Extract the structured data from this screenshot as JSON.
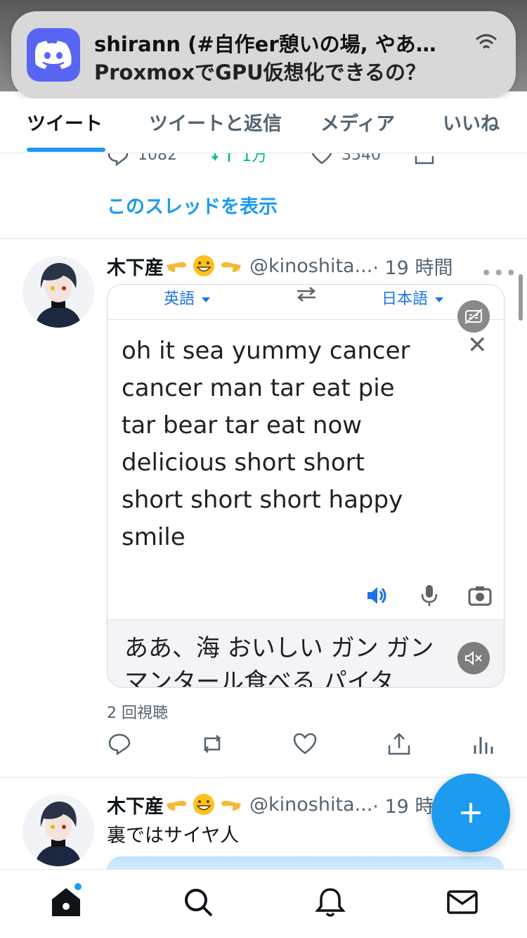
{
  "notification": {
    "app_icon": "discord-icon",
    "title": "shirann (#自作er憩いの場, やあ…",
    "body": "ProxmoxでGPU仮想化できるの？"
  },
  "tabs": [
    {
      "label": "ツイート",
      "active": true
    },
    {
      "label": "ツイートと返信",
      "active": false
    },
    {
      "label": "メディア",
      "active": false
    },
    {
      "label": "いいね",
      "active": false
    }
  ],
  "previous_tweet": {
    "replies": "1082",
    "retweets": "1万",
    "likes": "3540",
    "thread_link": "このスレッドを表示"
  },
  "tweet1": {
    "name": "木下産",
    "emojis": [
      "backhand-index-pointing-right",
      "grinning-face",
      "backhand-index-pointing-left"
    ],
    "handle": "@kinoshita...",
    "time": "· 19 時間",
    "more": "•••",
    "media": {
      "source_lang": "英語",
      "target_lang": "日本語",
      "source_text": [
        "oh it sea yummy cancer",
        "cancer man tar eat pie",
        "tar bear tar eat now",
        "delicious short short",
        "short short short happy",
        "smile"
      ],
      "translation_text": [
        "ああ、海 おいしい ガン ガン",
        "マンタール食べる パイタ"
      ]
    },
    "views": "2 回視聴"
  },
  "tweet2": {
    "name": "木下産",
    "handle": "@kinoshita...",
    "time": "· 19 時",
    "text": "裏ではサイヤ人"
  },
  "colors": {
    "accent": "#1d9bf0",
    "discord": "#5865f2",
    "translate_blue": "#1a73e8"
  }
}
